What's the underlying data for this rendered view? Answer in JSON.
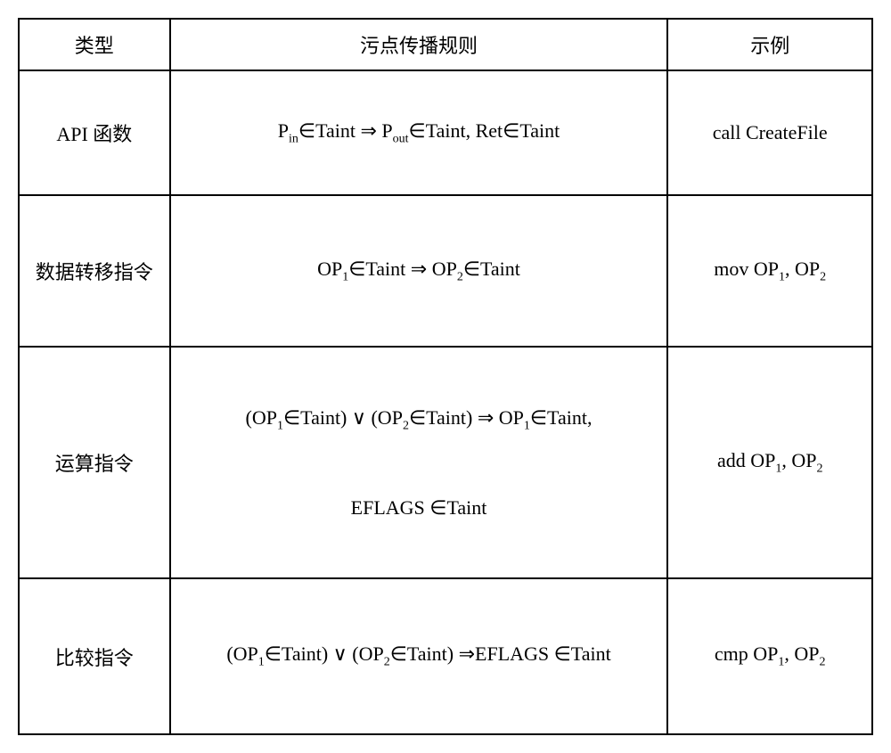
{
  "headers": {
    "type": "类型",
    "rule": "污点传播规则",
    "example": "示例"
  },
  "rows": [
    {
      "type": "API 函数",
      "rule_html": "P<sub>in</sub>∈Taint ⇒ P<sub>out</sub>∈Taint, Ret∈Taint",
      "example_html": "call CreateFile"
    },
    {
      "type": "数据转移指令",
      "rule_html": "OP<sub>1</sub>∈Taint ⇒ OP<sub>2</sub>∈Taint",
      "example_html": "mov OP<sub>1</sub>, OP<sub>2</sub>"
    },
    {
      "type": "运算指令",
      "rule_lines": [
        "(OP<sub>1</sub>∈Taint) ∨ (OP<sub>2</sub>∈Taint) ⇒ OP<sub>1</sub>∈Taint,",
        "EFLAGS ∈Taint"
      ],
      "example_html": "add OP<sub>1</sub>, OP<sub>2</sub>"
    },
    {
      "type": "比较指令",
      "rule_html": "(OP<sub>1</sub>∈Taint) ∨ (OP<sub>2</sub>∈Taint) ⇒EFLAGS ∈Taint",
      "example_html": "cmp OP<sub>1</sub>, OP<sub>2</sub>"
    }
  ]
}
